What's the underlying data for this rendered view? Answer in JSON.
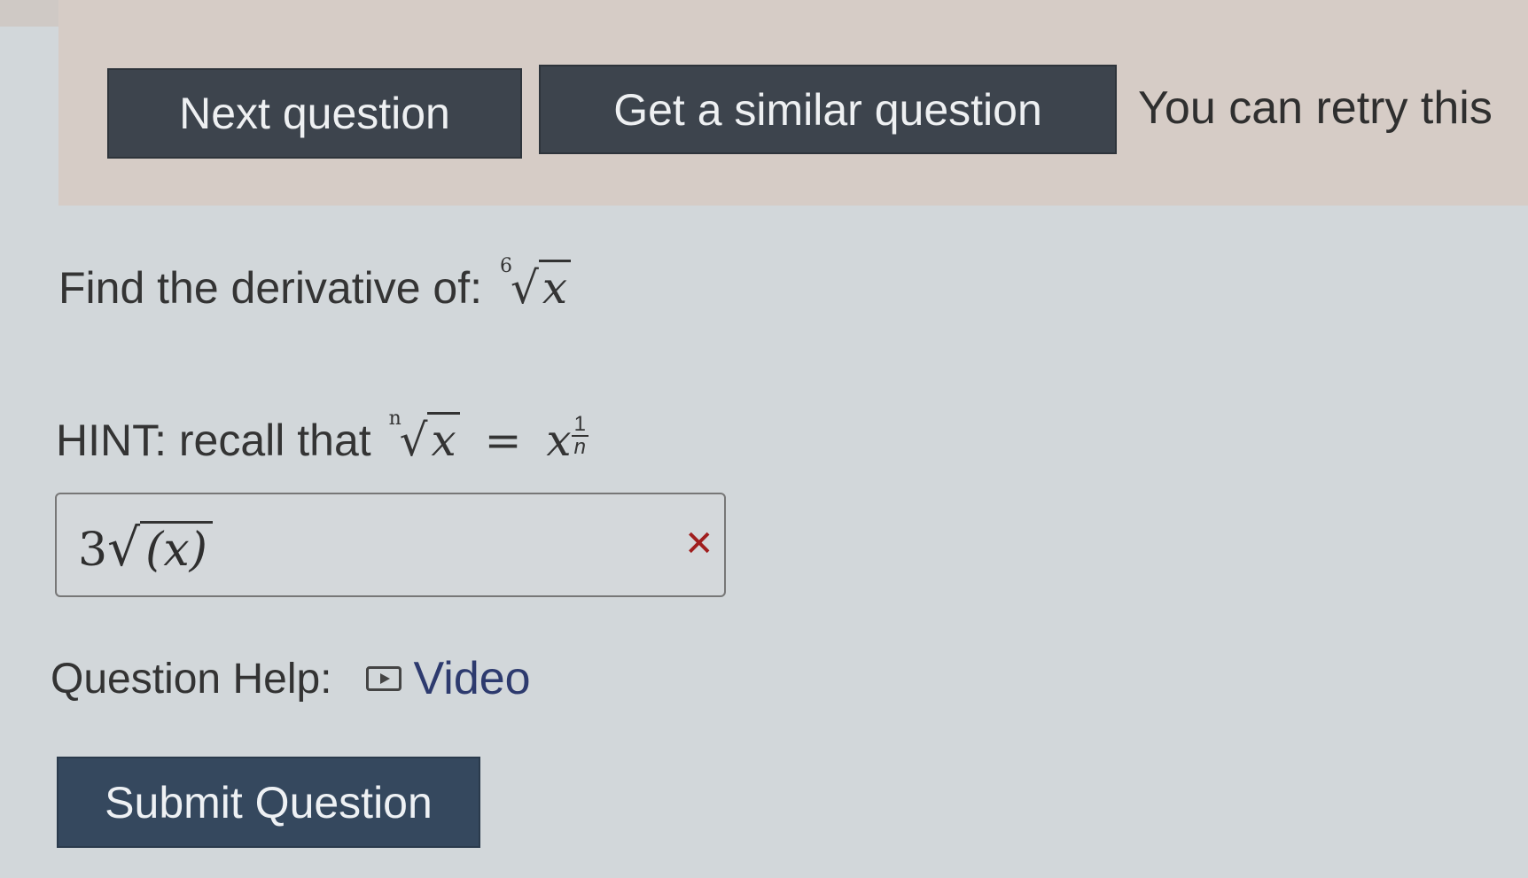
{
  "actions": {
    "next_label": "Next question",
    "similar_label": "Get a similar question",
    "retry_text": "You can retry this"
  },
  "question": {
    "prompt": "Find the derivative of:",
    "root_index": "6",
    "variable": "x"
  },
  "hint": {
    "prefix": "HINT: recall that",
    "root_index": "n",
    "variable": "x",
    "equals": "=",
    "base": "x",
    "exp_num": "1",
    "exp_den": "n"
  },
  "answer": {
    "coefficient": "3",
    "radical": "√",
    "radicand": "(x)",
    "status_icon": "wrong-x-icon",
    "status_color": "#a01e1e"
  },
  "help": {
    "label": "Question Help:",
    "video_label": "Video"
  },
  "submit_label": "Submit Question"
}
